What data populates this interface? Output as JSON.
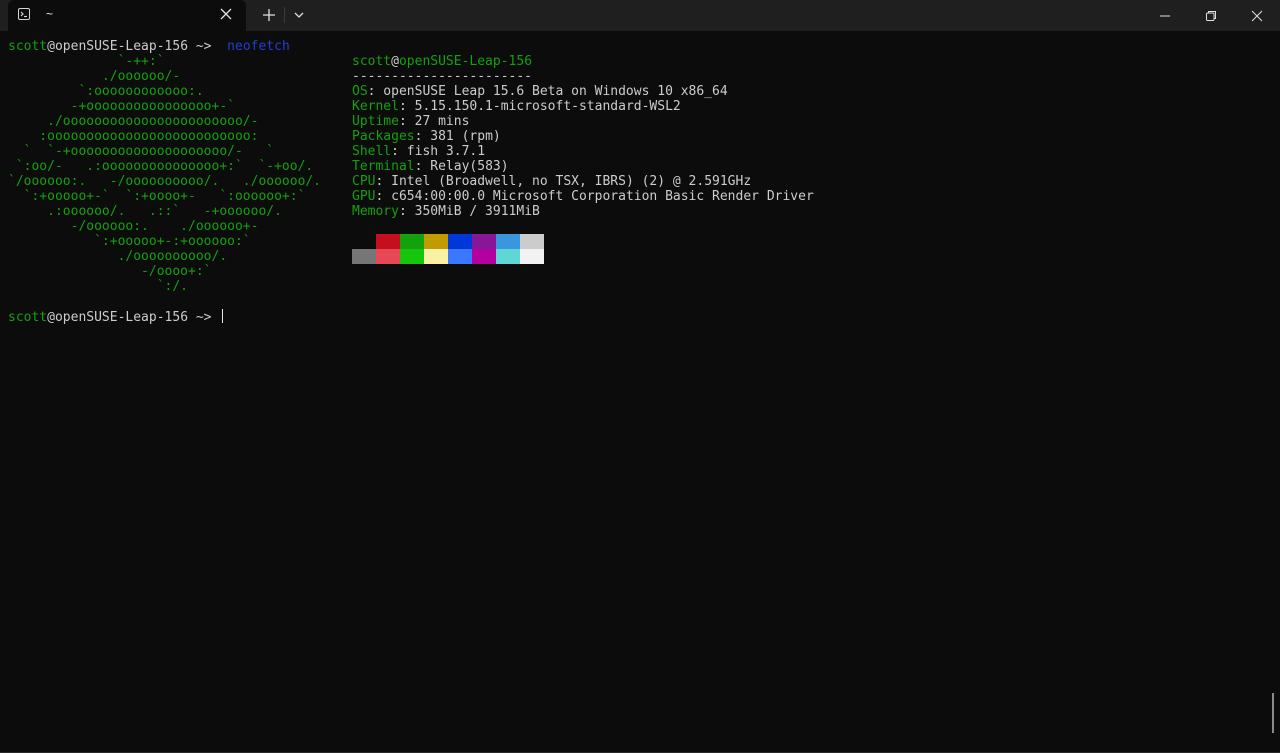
{
  "window": {
    "tab_title": "~",
    "tab_icon": "terminal-icon",
    "new_tab_icon": "plus-icon",
    "dropdown_icon": "chevron-down-icon",
    "minimize_icon": "minimize-icon",
    "maximize_icon": "restore-icon",
    "close_icon": "close-icon"
  },
  "colors": {
    "background": "#0c0c0c",
    "titlebar": "#1f1f1f",
    "prompt_green": "#13a10e",
    "text": "#cccccc",
    "command_blue": "#1f3fd0"
  },
  "prompt1": {
    "user": "scott",
    "host": "@openSUSE-Leap-156",
    "path": " ~> ",
    "command": "neofetch"
  },
  "logo": [
    "              `-++:`",
    "            ./oooooo/-",
    "         `:oooooooooooo:.",
    "        -+oooooooooooooooo+-`",
    "     ./ooooooooooooooooooooooo/-",
    "    :oooooooooooooooooooooooooo:",
    "  `  `-+oooooooooooooooooooo/-   `",
    " `:oo/-   .:ooooooooooooooo+:`  `-+oo/.",
    "`/oooooo:.   -/oooooooooo/.   ./oooooo/.",
    "  `:+ooooo+-`  `:+oooo+-   `:oooooo+:`",
    "     .:oooooo/.   .::`   -+oooooo/.",
    "        -/oooooo:.    ./oooooo+-",
    "           `:+ooooo+-:+oooooo:`",
    "              ./oooooooooo/.",
    "                 -/oooo+:`",
    "                   `:/."
  ],
  "info": {
    "user": "scott",
    "at": "@",
    "host": "openSUSE-Leap-156",
    "separator": "-----------------------",
    "fields": [
      {
        "key": "OS",
        "value": ": openSUSE Leap 15.6 Beta on Windows 10 x86_64"
      },
      {
        "key": "Kernel",
        "value": ": 5.15.150.1-microsoft-standard-WSL2"
      },
      {
        "key": "Uptime",
        "value": ": 27 mins"
      },
      {
        "key": "Packages",
        "value": ": 381 (rpm)"
      },
      {
        "key": "Shell",
        "value": ": fish 3.7.1"
      },
      {
        "key": "Terminal",
        "value": ": Relay(583)"
      },
      {
        "key": "CPU",
        "value": ": Intel (Broadwell, no TSX, IBRS) (2) @ 2.591GHz"
      },
      {
        "key": "GPU",
        "value": ": c654:00:00.0 Microsoft Corporation Basic Render Driver"
      },
      {
        "key": "Memory",
        "value": ": 350MiB / 3911MiB"
      }
    ]
  },
  "palette_row1": [
    "#0c0c0c",
    "#c50f1f",
    "#13a10e",
    "#c19c00",
    "#0037da",
    "#881798",
    "#3a96dd",
    "#cccccc"
  ],
  "palette_row2": [
    "#767676",
    "#e74856",
    "#16c60c",
    "#f9f1a5",
    "#3b78ff",
    "#b4009e",
    "#61d6d6",
    "#f2f2f2"
  ],
  "prompt2": {
    "user": "scott",
    "host": "@openSUSE-Leap-156",
    "path": " ~> "
  }
}
